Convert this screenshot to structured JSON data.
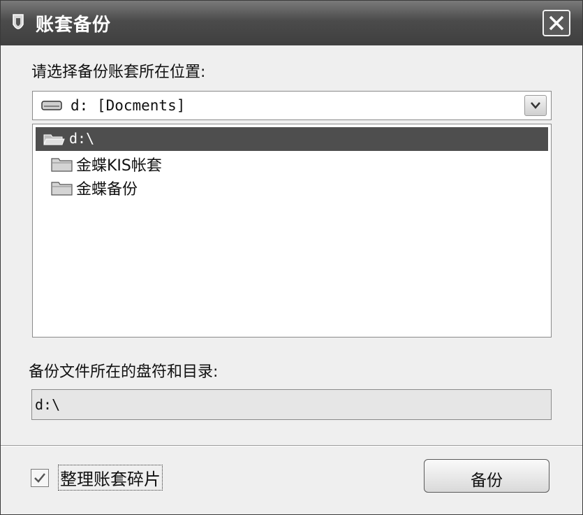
{
  "window": {
    "title": "账套备份"
  },
  "location": {
    "label": "请选择备份账套所在位置:",
    "drive_value": "d:  [Docments]"
  },
  "directory": {
    "root": "d:\\",
    "folders": [
      {
        "label": "金蝶KIS帐套"
      },
      {
        "label": "金蝶备份"
      }
    ]
  },
  "target": {
    "label": "备份文件所在的盘符和目录:",
    "path": "d:\\"
  },
  "options": {
    "defrag_label": "整理账套碎片",
    "defrag_checked": true
  },
  "actions": {
    "backup_label": "备份"
  },
  "colors": {
    "titlebar": "#4b4b4b",
    "selection": "#4e4e4e",
    "dialog_bg": "#efefef"
  }
}
